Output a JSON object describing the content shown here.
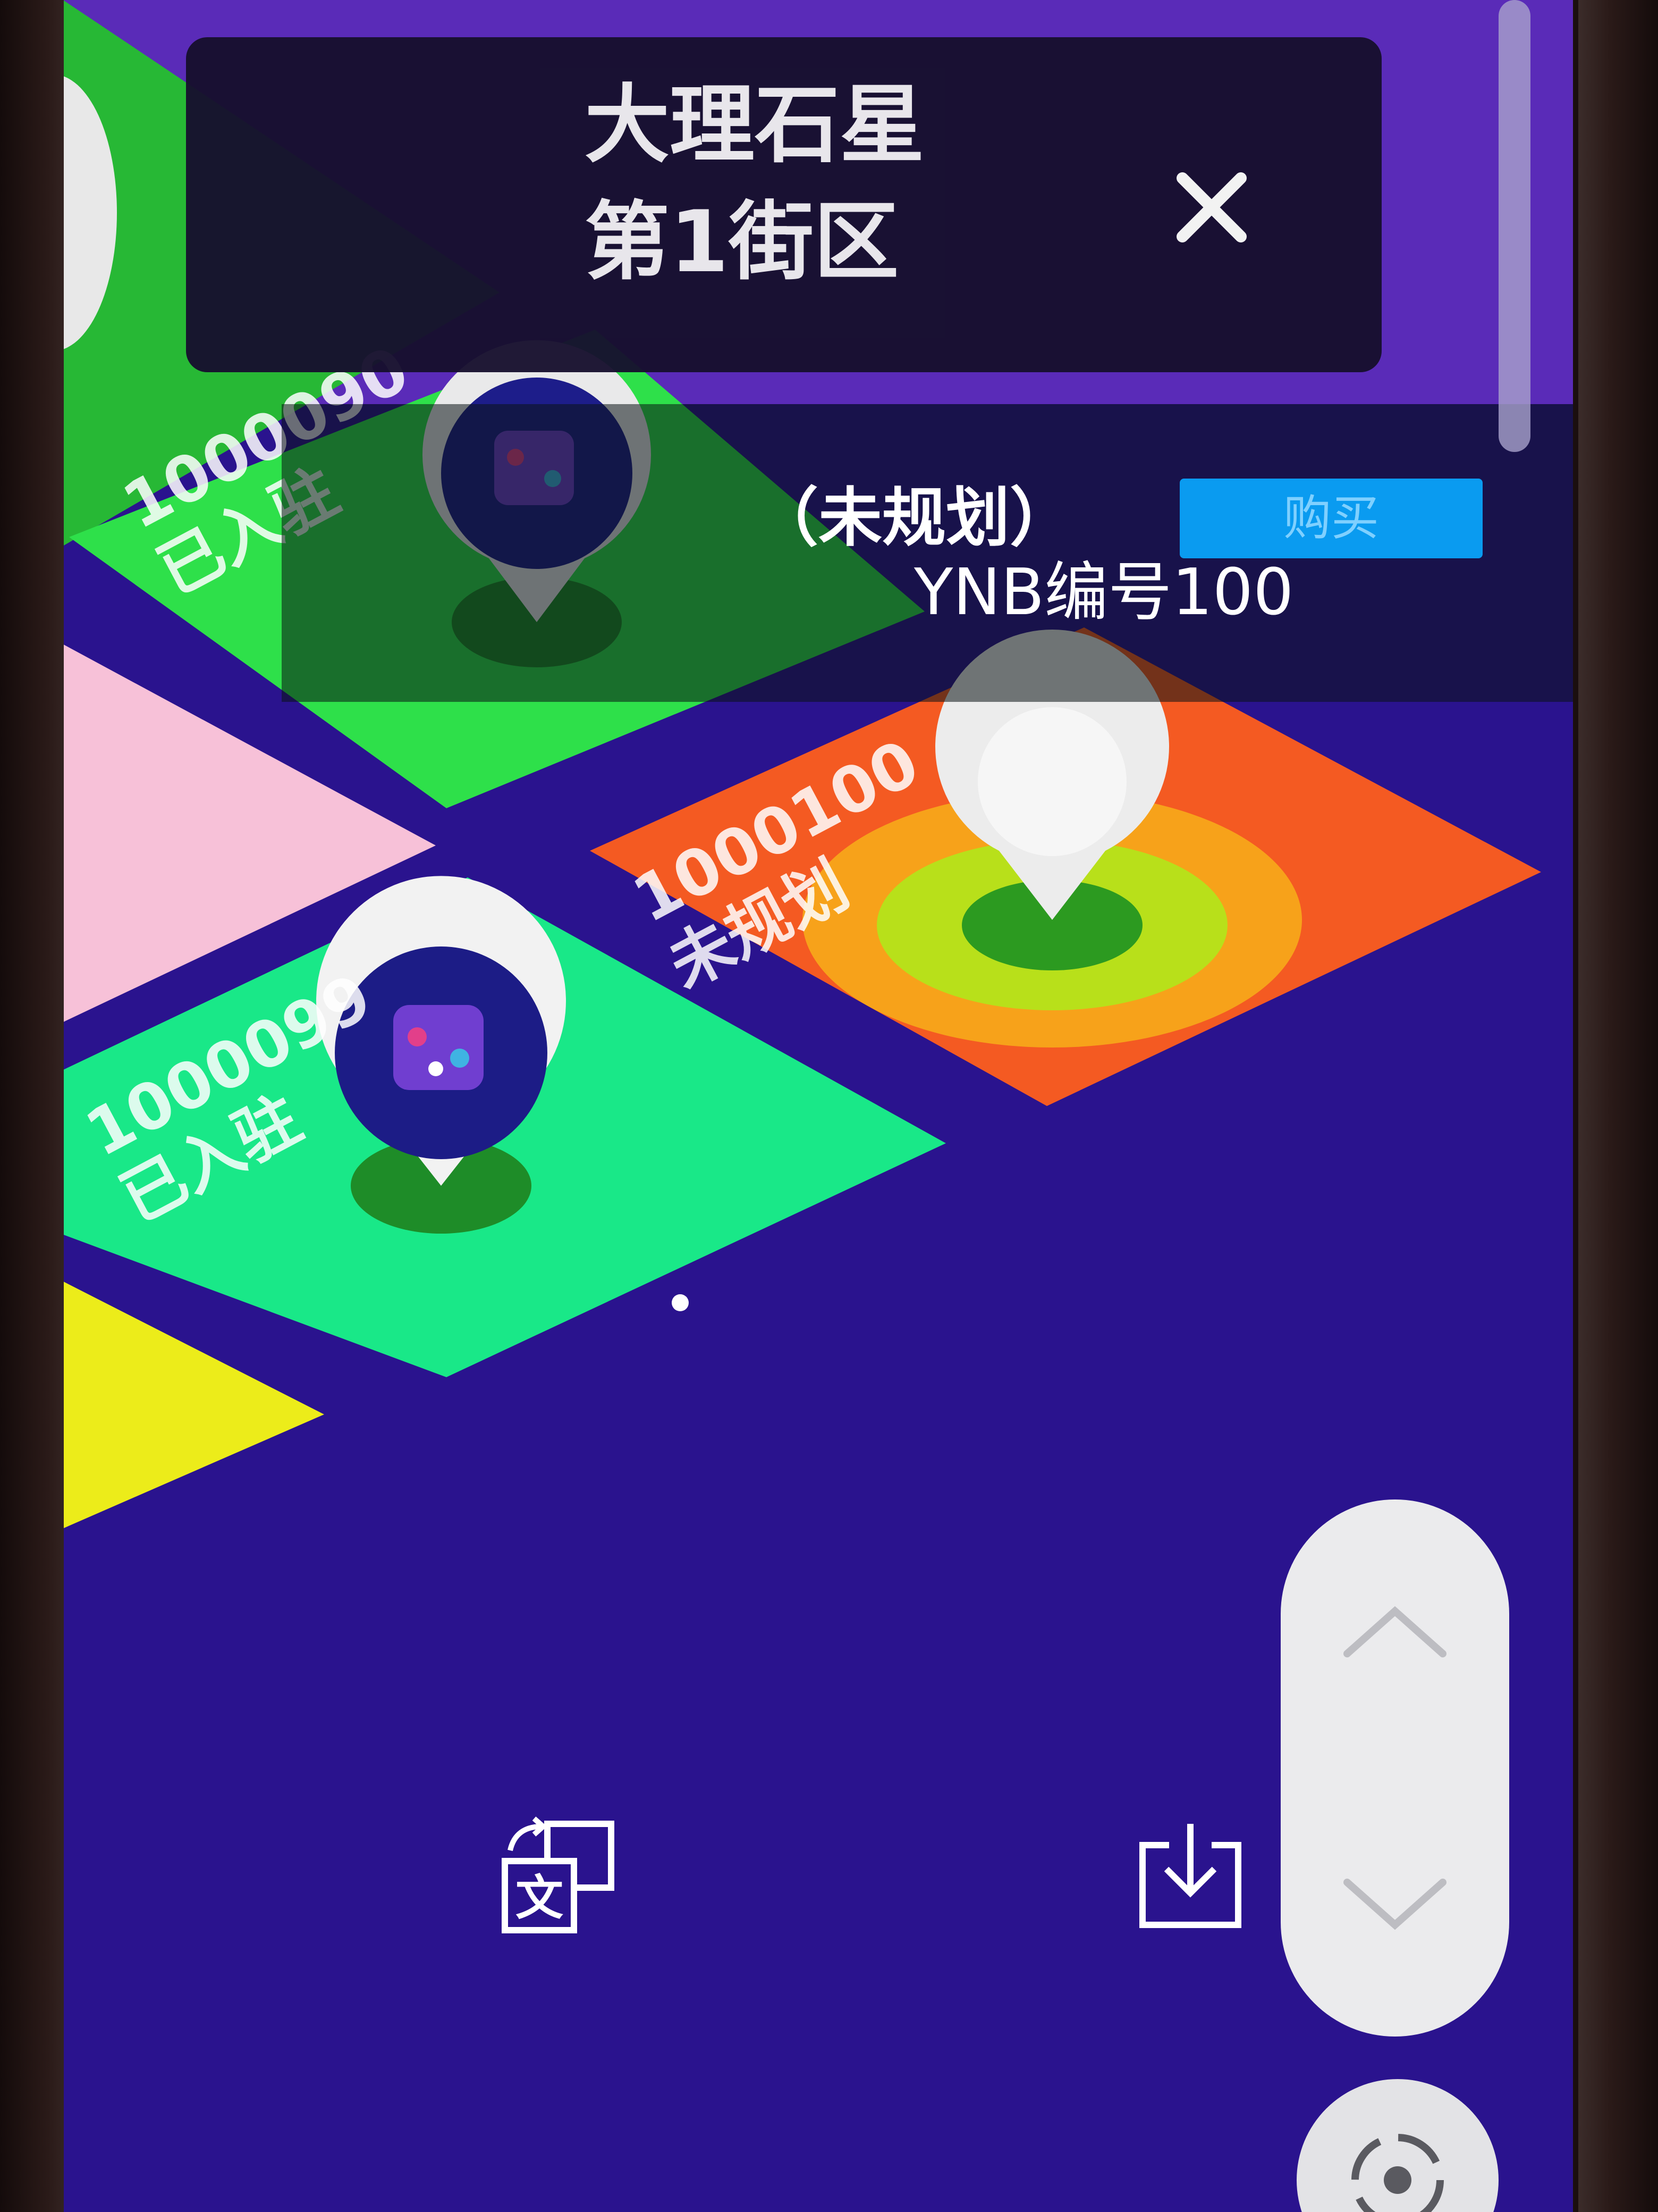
{
  "header": {
    "planet": "大理石星",
    "district": "第1街区",
    "close_icon": "close-icon"
  },
  "selected_plot": {
    "status": "（未规划）",
    "action_button_label": "购买",
    "plot_number": "YNB编号100"
  },
  "tiles": [
    {
      "id": "1000090",
      "status": "已入驻",
      "color": "#2ee04a",
      "has_pin_logo": true
    },
    {
      "id": "1000100",
      "status": "未规划",
      "color": "#f45a22",
      "has_pin_logo": false,
      "selected": true
    },
    {
      "id": "1000099",
      "status": "已入驻",
      "color": "#19e888",
      "has_pin_logo": true
    },
    {
      "id": "",
      "status": "",
      "color": "#f7c1d8",
      "has_pin_logo": false
    },
    {
      "id": "",
      "status": "",
      "color": "#ecec1a",
      "has_pin_logo": false
    },
    {
      "id": "",
      "status": "",
      "color": "#27b835",
      "has_pin_logo": false
    }
  ],
  "tile_labels": {
    "t1_id": "1000090",
    "t1_status": "已入驻",
    "t2_id": "1000100",
    "t2_status": "未规划",
    "t3_id": "1000099",
    "t3_status": "已入驻"
  },
  "controls": {
    "zoom_in_icon": "chevron-up-icon",
    "zoom_out_icon": "chevron-down-icon",
    "locate_icon": "locate-icon",
    "translate_icon": "translate-icon",
    "download_icon": "download-icon"
  },
  "colors": {
    "background": "#2a138e",
    "accent_button": "#0a9bf0",
    "header_card": "#17102e"
  }
}
